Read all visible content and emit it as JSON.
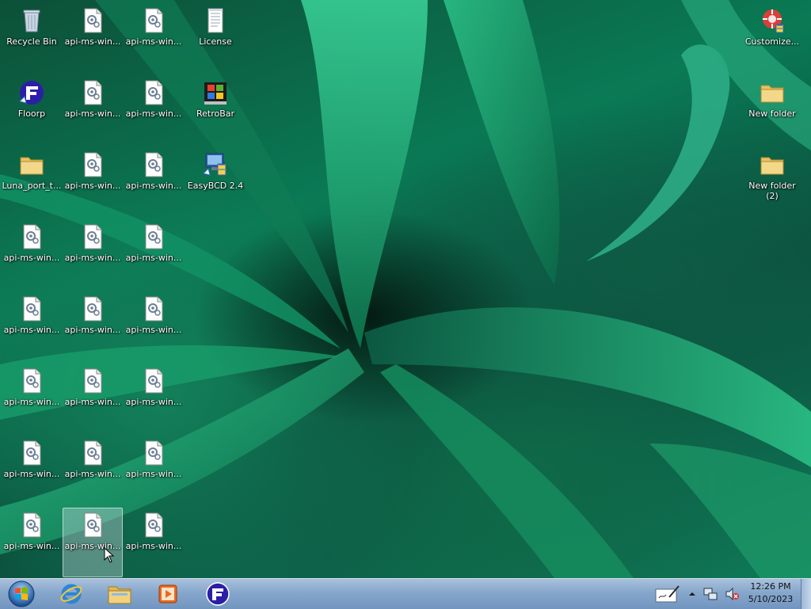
{
  "desktop": {
    "icons": {
      "recycle_bin": "Recycle Bin",
      "floorp": "Floorp",
      "luna_port": "Luna_port_t...",
      "license": "License",
      "retrobar": "RetroBar",
      "easybcd": "EasyBCD 2.4",
      "customize": "Customize...",
      "new_folder": "New folder",
      "new_folder_2": "New folder (2)",
      "api_file": "api-ms-win..."
    }
  },
  "taskbar": {
    "pinned": [
      "start-orb",
      "internet-explorer-icon",
      "file-explorer-icon",
      "media-player-icon",
      "floorp-icon"
    ],
    "tray": {
      "time": "12:26 PM",
      "date": "5/10/2023"
    }
  },
  "colors": {
    "taskbar": "#86a7cc",
    "selection": "#dce6f0"
  }
}
